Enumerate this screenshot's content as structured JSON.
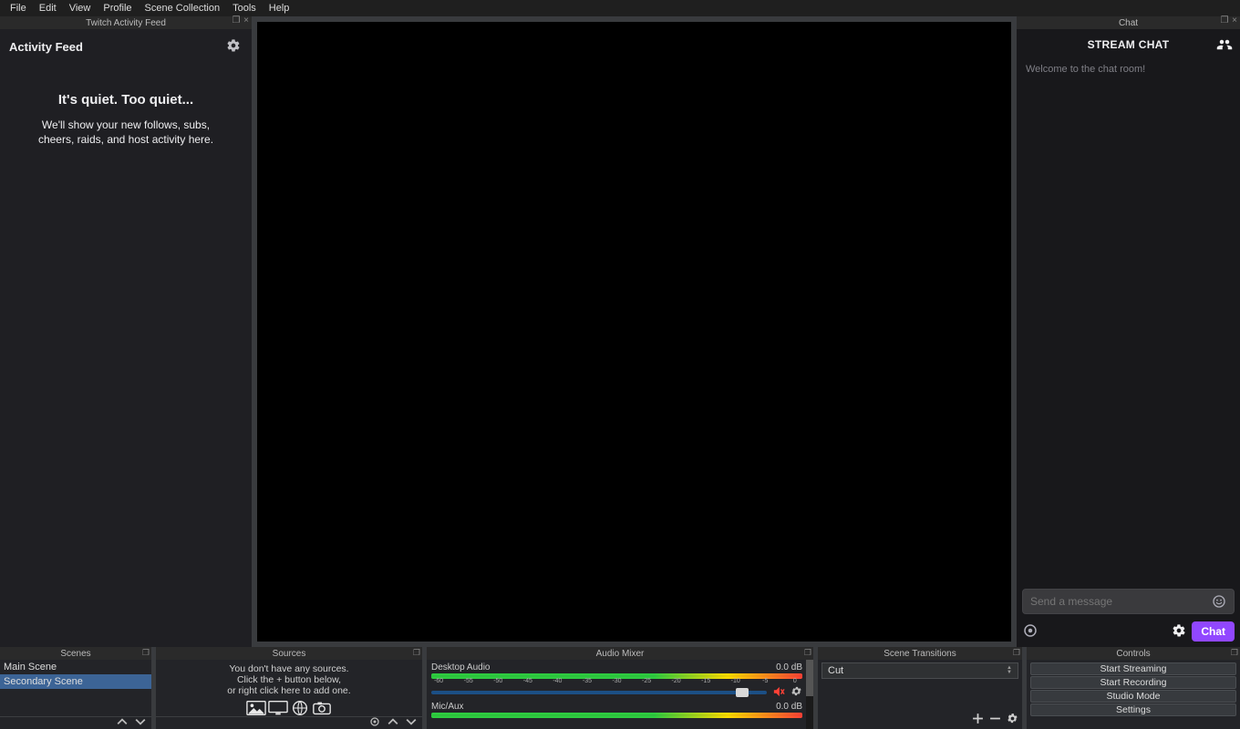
{
  "menubar": {
    "items": [
      "File",
      "Edit",
      "View",
      "Profile",
      "Scene Collection",
      "Tools",
      "Help"
    ]
  },
  "docks": {
    "activityFeed": {
      "dockTitle": "Twitch Activity Feed",
      "heading": "Activity Feed",
      "emptyTitle": "It's quiet. Too quiet...",
      "emptyLine1": "We'll show your new follows, subs,",
      "emptyLine2": "cheers, raids, and host activity here."
    },
    "chat": {
      "dockTitle": "Chat",
      "title": "STREAM CHAT",
      "systemMessage": "Welcome to the chat room!",
      "placeholder": "Send a message",
      "sendLabel": "Chat"
    },
    "scenes": {
      "title": "Scenes",
      "items": [
        {
          "label": "Main Scene",
          "selected": false
        },
        {
          "label": "Secondary Scene",
          "selected": true
        }
      ]
    },
    "sources": {
      "title": "Sources",
      "line1": "You don't have any sources.",
      "line2": "Click the + button below,",
      "line3": "or right click here to add one."
    },
    "mixer": {
      "title": "Audio Mixer",
      "ticks": [
        "-60",
        "-55",
        "-50",
        "-45",
        "-40",
        "-35",
        "-30",
        "-25",
        "-20",
        "-15",
        "-10",
        "-5",
        "0"
      ],
      "channels": [
        {
          "name": "Desktop Audio",
          "level": "0.0 dB",
          "muted": true
        },
        {
          "name": "Mic/Aux",
          "level": "0.0 dB",
          "muted": true
        }
      ]
    },
    "transitions": {
      "title": "Scene Transitions",
      "selected": "Cut"
    },
    "controls": {
      "title": "Controls",
      "buttons": [
        "Start Streaming",
        "Start Recording",
        "Studio Mode",
        "Settings"
      ]
    }
  }
}
